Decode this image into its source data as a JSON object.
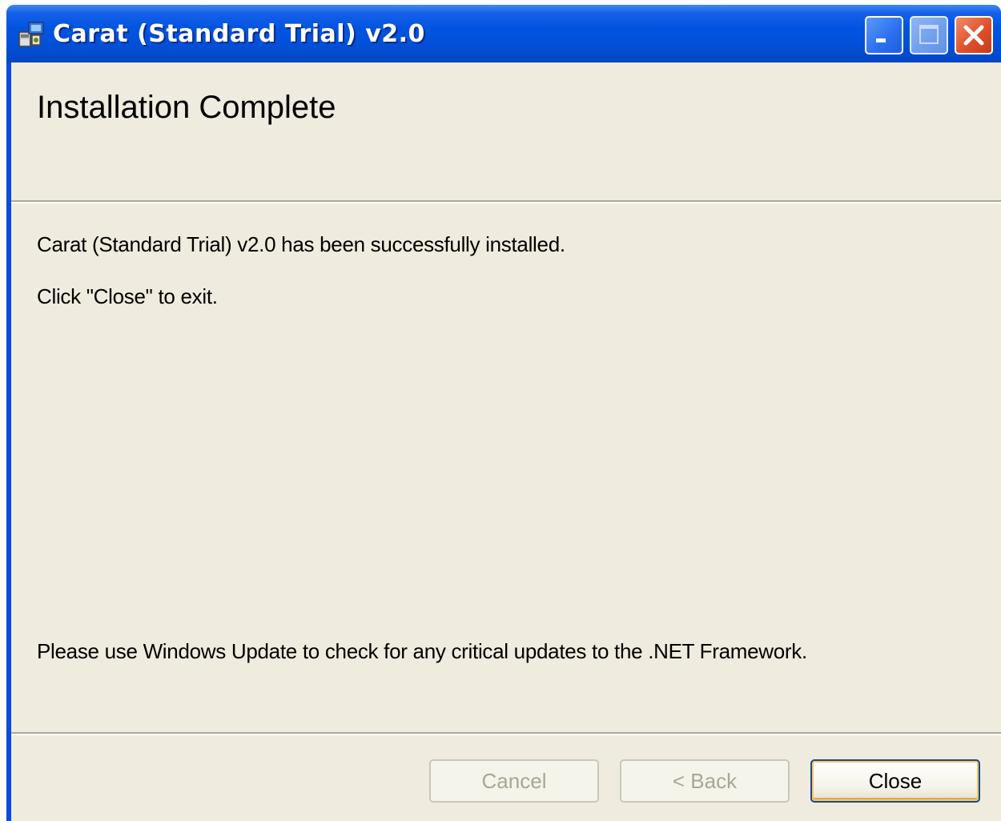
{
  "window": {
    "title": "Carat (Standard Trial) v2.0",
    "controls": {
      "minimize": "minimize-icon",
      "maximize": "maximize-icon",
      "close": "close-icon"
    },
    "title_bar_color": "#0254e0",
    "close_button_color": "#e0502a"
  },
  "header": {
    "title": "Installation Complete"
  },
  "body": {
    "success_message": "Carat (Standard Trial) v2.0 has been successfully installed.",
    "exit_instruction": "Click \"Close\" to exit.",
    "update_notice": "Please use Windows Update to check for any critical updates to the .NET Framework."
  },
  "buttons": {
    "cancel": {
      "label": "Cancel",
      "enabled": false
    },
    "back": {
      "label": "< Back",
      "enabled": false
    },
    "close": {
      "label": "Close",
      "enabled": true
    }
  },
  "colors": {
    "dialog_background": "#efebde",
    "disabled_text": "#a8a695",
    "default_button_border": "#1d4a88"
  }
}
